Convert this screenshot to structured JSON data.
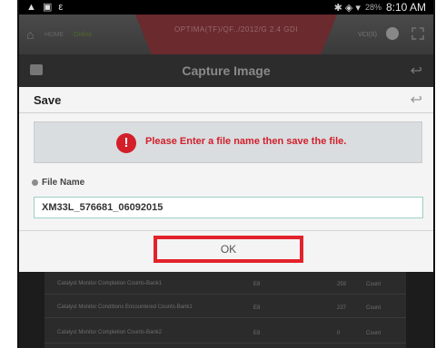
{
  "status_bar": {
    "left_icons": "▲ ▣ ε",
    "right_icons": "✱ ◈ ▾",
    "battery": "28%",
    "time": "8:10 AM"
  },
  "app_header": {
    "home_label": "HOME",
    "home_sub": "Online",
    "vehicle": "OPTIMA(TF)/QF../2012/G 2.4 GDI",
    "vci_label": "VCI(S)"
  },
  "capture_bar": {
    "title": "Capture Image"
  },
  "dialog": {
    "title": "Save",
    "alert_icon": "!",
    "alert_message": "Please Enter a file name then save the file.",
    "file_name_label": "File Name",
    "file_name_value": "XM33L_576681_06092015",
    "ok_label": "OK"
  },
  "table": {
    "rows": [
      {
        "name": "Catalyst Monitor Completion Counts-Bank1",
        "code": "E8",
        "value": "259",
        "unit": "Count"
      },
      {
        "name": "Catalyst Monitor Conditions Encountered Counts-Bank1",
        "code": "E8",
        "value": "237",
        "unit": "Count"
      },
      {
        "name": "Catalyst Monitor Completion Counts-Bank2",
        "code": "E8",
        "value": "0",
        "unit": "Count"
      }
    ]
  },
  "colors": {
    "accent_red": "#d21f2a",
    "highlight_border": "#e3222b"
  }
}
